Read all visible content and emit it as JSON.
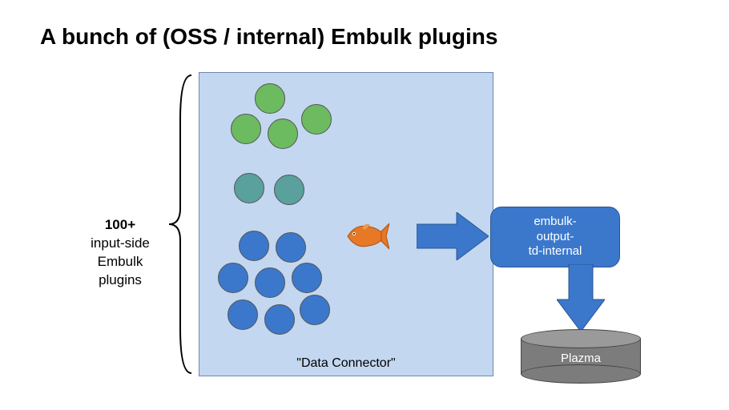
{
  "title": "A bunch of (OSS / internal) Embulk plugins",
  "sidebar": {
    "count_label": "100+",
    "line1": "input-side",
    "line2": "Embulk",
    "line3": "plugins"
  },
  "connector_label": "\"Data Connector\"",
  "output_box": {
    "line1": "embulk-",
    "line2": "output-",
    "line3": "td-internal"
  },
  "store_label": "Plazma",
  "colors": {
    "green": "#6dbb60",
    "teal": "#5aa09c",
    "blue": "#3b78cc",
    "box_bg": "#c3d7f0",
    "arrow": "#3b78cc",
    "cylinder": "#7c7c7c"
  },
  "diagram_notes": {
    "green_circles": 4,
    "teal_circles": 2,
    "blue_circles": 8,
    "fish_icon": "orange fish (Embulk/logo-like)"
  }
}
